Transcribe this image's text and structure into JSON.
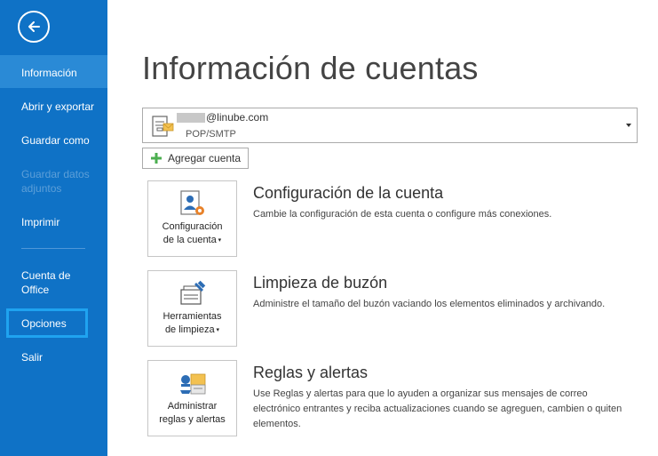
{
  "sidebar": {
    "items": [
      {
        "label": "Información"
      },
      {
        "label": "Abrir y exportar"
      },
      {
        "label": "Guardar como"
      },
      {
        "label": "Guardar datos adjuntos"
      },
      {
        "label": "Imprimir"
      },
      {
        "label": "Cuenta de Office"
      },
      {
        "label": "Opciones"
      },
      {
        "label": "Salir"
      }
    ]
  },
  "main": {
    "title": "Información de cuentas",
    "account": {
      "email": "@linube.com",
      "type": "POP/SMTP"
    },
    "add_account_label": "Agregar cuenta",
    "sections": [
      {
        "tile_label_1": "Configuración",
        "tile_label_2": "de la cuenta",
        "title": "Configuración de la cuenta",
        "description": "Cambie la configuración de esta cuenta o configure más conexiones."
      },
      {
        "tile_label_1": "Herramientas",
        "tile_label_2": "de limpieza",
        "title": "Limpieza de buzón",
        "description": "Administre el tamaño del buzón vaciando los elementos eliminados y archivando."
      },
      {
        "tile_label_1": "Administrar",
        "tile_label_2": "reglas y alertas",
        "title": "Reglas y alertas",
        "description": "Use Reglas y alertas para que lo ayuden a organizar sus mensajes de correo electrónico entrantes y reciba actualizaciones cuando se agreguen, cambien o quiten elementos."
      }
    ]
  },
  "colors": {
    "sidebar": "#0f72c6",
    "sidebar_active": "#2a8ad6",
    "highlight_frame": "#1fa3f0"
  },
  "icons": [
    "back-arrow-icon",
    "account-icon",
    "plus-icon",
    "account-settings-icon",
    "cleanup-tools-icon",
    "rules-alerts-icon"
  ]
}
